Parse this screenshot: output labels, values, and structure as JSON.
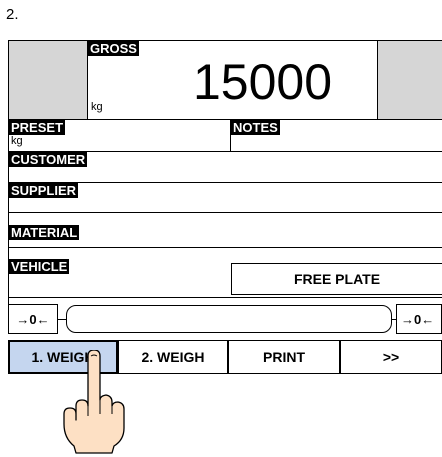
{
  "step_number": "2.",
  "weight": {
    "label": "GROSS",
    "value": "15000",
    "unit": "kg"
  },
  "fields": {
    "preset": {
      "label": "PRESET",
      "unit": "kg"
    },
    "notes": {
      "label": "NOTES"
    },
    "customer": {
      "label": "CUSTOMER"
    },
    "supplier": {
      "label": "SUPPLIER"
    },
    "material": {
      "label": "MATERIAL"
    },
    "vehicle": {
      "label": "VEHICLE"
    }
  },
  "free_plate_label": "FREE PLATE",
  "zero_left": "→0←",
  "zero_right": "→0←",
  "buttons": {
    "weigh1": "1. WEIGH",
    "weigh2": "2. WEIGH",
    "print": "PRINT",
    "more": ">>"
  },
  "colors": {
    "panel_gray": "#d6d6d6",
    "active_button": "#c5d6ef",
    "skin": "#fde0c4"
  },
  "icons": {
    "pointer": "hand-pointer-icon"
  }
}
